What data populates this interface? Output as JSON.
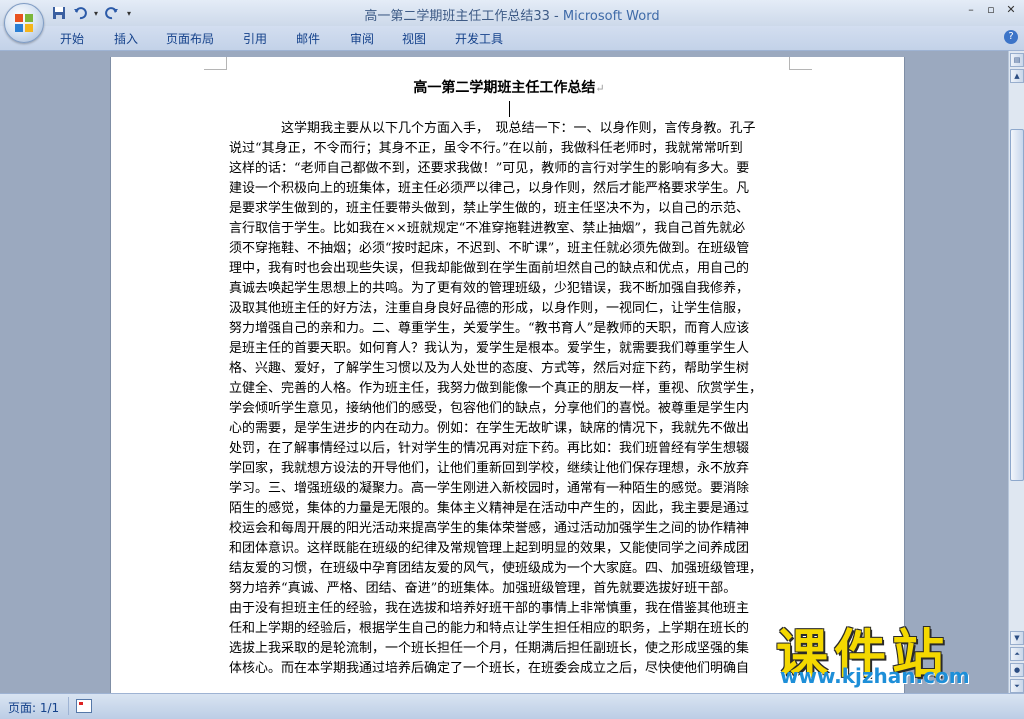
{
  "window": {
    "document_name": "高一第二学期班主任工作总结33",
    "separator": " - ",
    "app_name": "Microsoft Word"
  },
  "ribbon": {
    "tabs": [
      "开始",
      "插入",
      "页面布局",
      "引用",
      "邮件",
      "审阅",
      "视图",
      "开发工具"
    ]
  },
  "document": {
    "title": "高一第二学期班主任工作总结",
    "lines": [
      "　　　　这学期我主要从以下几个方面入手，　现总结一下：一、以身作则，言传身教。孔子",
      "说过“其身正，不令而行；其身不正，虽令不行。”在以前，我做科任老师时，我就常常听到",
      "这样的话：“老师自己都做不到，还要求我做！”可见，教师的言行对学生的影响有多大。要",
      "建设一个积极向上的班集体，班主任必须严以律己，以身作则，然后才能严格要求学生。凡",
      "是要求学生做到的，班主任要带头做到，禁止学生做的，班主任坚决不为，以自己的示范、",
      "言行取信于学生。比如我在××班就规定“不准穿拖鞋进教室、禁止抽烟”，我自己首先就必",
      "须不穿拖鞋、不抽烟；必须“按时起床，不迟到、不旷课”，班主任就必须先做到。在班级管",
      "理中，我有时也会出现些失误，但我却能做到在学生面前坦然自己的缺点和优点，用自己的",
      "真诚去唤起学生思想上的共鸣。为了更有效的管理班级，少犯错误，我不断加强自我修养，",
      "汲取其他班主任的好方法，注重自身良好品德的形成，以身作则，一视同仁，让学生信服，",
      "努力增强自己的亲和力。二、尊重学生，关爱学生。“教书育人”是教师的天职，而育人应该",
      "是班主任的首要天职。如何育人？我认为，爱学生是根本。爱学生，就需要我们尊重学生人",
      "格、兴趣、爱好，了解学生习惯以及为人处世的态度、方式等，然后对症下药，帮助学生树",
      "立健全、完善的人格。作为班主任，我努力做到能像一个真正的朋友一样，重视、欣赏学生，",
      "学会倾听学生意见，接纳他们的感受，包容他们的缺点，分享他们的喜悦。被尊重是学生内",
      "心的需要，是学生进步的内在动力。例如：在学生无故旷课，缺席的情况下，我就先不做出",
      "处罚，在了解事情经过以后，针对学生的情况再对症下药。再比如：我们班曾经有学生想辍",
      "学回家，我就想方设法的开导他们，让他们重新回到学校，继续让他们保存理想，永不放弃",
      "学习。三、增强班级的凝聚力。高一学生刚进入新校园时，通常有一种陌生的感觉。要消除",
      "陌生的感觉，集体的力量是无限的。集体主义精神是在活动中产生的，因此，我主要是通过",
      "校运会和每周开展的阳光活动来提高学生的集体荣誉感，通过活动加强学生之间的协作精神",
      "和团体意识。这样既能在班级的纪律及常规管理上起到明显的效果，又能使同学之间养成团",
      "结友爱的习惯，在班级中孕育团结友爱的风气，使班级成为一个大家庭。四、加强班级管理，",
      "努力培养“真诚、严格、团结、奋进”的班集体。加强班级管理，首先就要选拔好班干部。",
      "由于没有担班主任的经验，我在选拔和培养好班干部的事情上非常慎重，我在借鉴其他班主",
      "任和上学期的经验后，根据学生自己的能力和特点让学生担任相应的职务，上学期在班长的",
      "选拔上我采取的是轮流制，一个班长担任一个月，任期满后担任副班长，使之形成坚强的集",
      "体核心。而在本学期我通过培养后确定了一个班长，在班委会成立之后，尽快使他们明确自"
    ]
  },
  "statusbar": {
    "page_info": "页面: 1/1"
  },
  "watermark": {
    "cn": "课件站",
    "url": "www.kjzhan.com"
  },
  "colors": {
    "title_text": "#3e5b86",
    "tab_text": "#15428b",
    "watermark_yellow": "#f4d800",
    "watermark_blue": "#1e8fd8"
  }
}
